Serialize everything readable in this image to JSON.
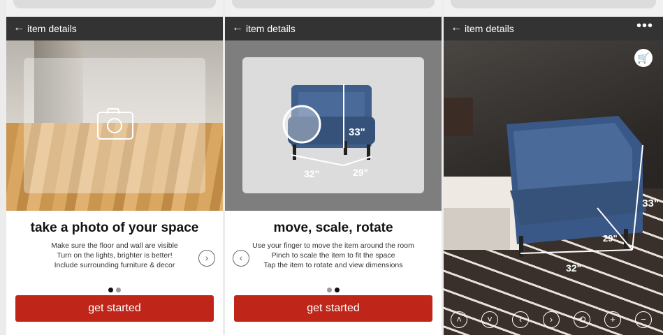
{
  "panels": [
    {
      "header": {
        "title": "item details"
      },
      "heading": "take a photo of your space",
      "lines": [
        "Make sure the floor and wall are visible",
        "Turn on the lights, brighter is better!",
        "Include surrounding furniture & decor"
      ],
      "button": "get started",
      "dots_active": 1
    },
    {
      "header": {
        "title": "item details"
      },
      "heading": "move, scale, rotate",
      "lines": [
        "Use your finger to move the item around the room",
        "Pinch to scale the item to fit the space",
        "Tap the item to rotate and view dimensions"
      ],
      "button": "get started",
      "dots_active": 2,
      "dimensions": {
        "height": "33\"",
        "width": "32\"",
        "depth": "29\""
      }
    },
    {
      "header": {
        "title": "item details"
      },
      "dimensions": {
        "height": "33\"",
        "width": "32\"",
        "depth": "29\""
      }
    }
  ],
  "icons": {
    "back": "arrow-left-icon",
    "camera": "camera-icon",
    "next": "chevron-right-icon",
    "prev": "chevron-left-icon",
    "more": "more-dots-icon",
    "cart": "cart-icon",
    "controls": [
      "chevron-up-icon",
      "chevron-down-icon",
      "chevron-left-icon",
      "chevron-right-icon",
      "rotate-icon",
      "plus-icon",
      "minus-icon"
    ]
  },
  "colors": {
    "header": "#333333",
    "button": "#bf2619",
    "chair": "#3f5e8a"
  }
}
